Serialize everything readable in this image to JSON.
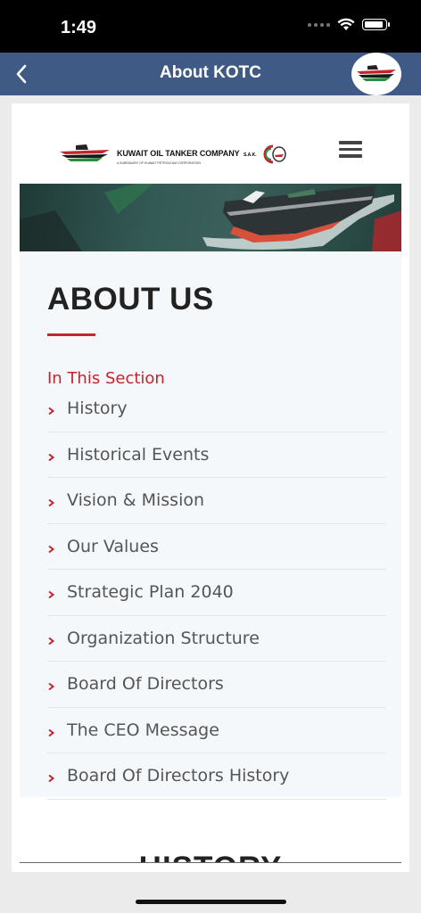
{
  "status_bar": {
    "time": "1:49"
  },
  "nav": {
    "title": "About KOTC",
    "back_icon": "chevron-left-icon",
    "logo_icon": "kotc-ship-logo-icon"
  },
  "site_header": {
    "company_name": "KUWAIT OIL TANKER COMPANY",
    "company_suffix": "S.A.K.",
    "company_sub": "A SUBSIDIARY OF KUWAIT PETROLEUM CORPORATION",
    "menu_icon": "hamburger-menu-icon"
  },
  "about": {
    "title": "ABOUT US",
    "section_label": "In This Section",
    "items": [
      {
        "label": "History"
      },
      {
        "label": "Historical Events"
      },
      {
        "label": "Vision & Mission"
      },
      {
        "label": "Our Values"
      },
      {
        "label": "Strategic Plan 2040"
      },
      {
        "label": "Organization Structure"
      },
      {
        "label": "Board Of Directors"
      },
      {
        "label": "The CEO Message"
      },
      {
        "label": "Board Of Directors History"
      }
    ]
  },
  "history": {
    "heading": "HISTORY"
  },
  "colors": {
    "nav_bg": "#3f5a85",
    "accent_red": "#c3252c",
    "panel_bg": "#f5f8fb"
  }
}
